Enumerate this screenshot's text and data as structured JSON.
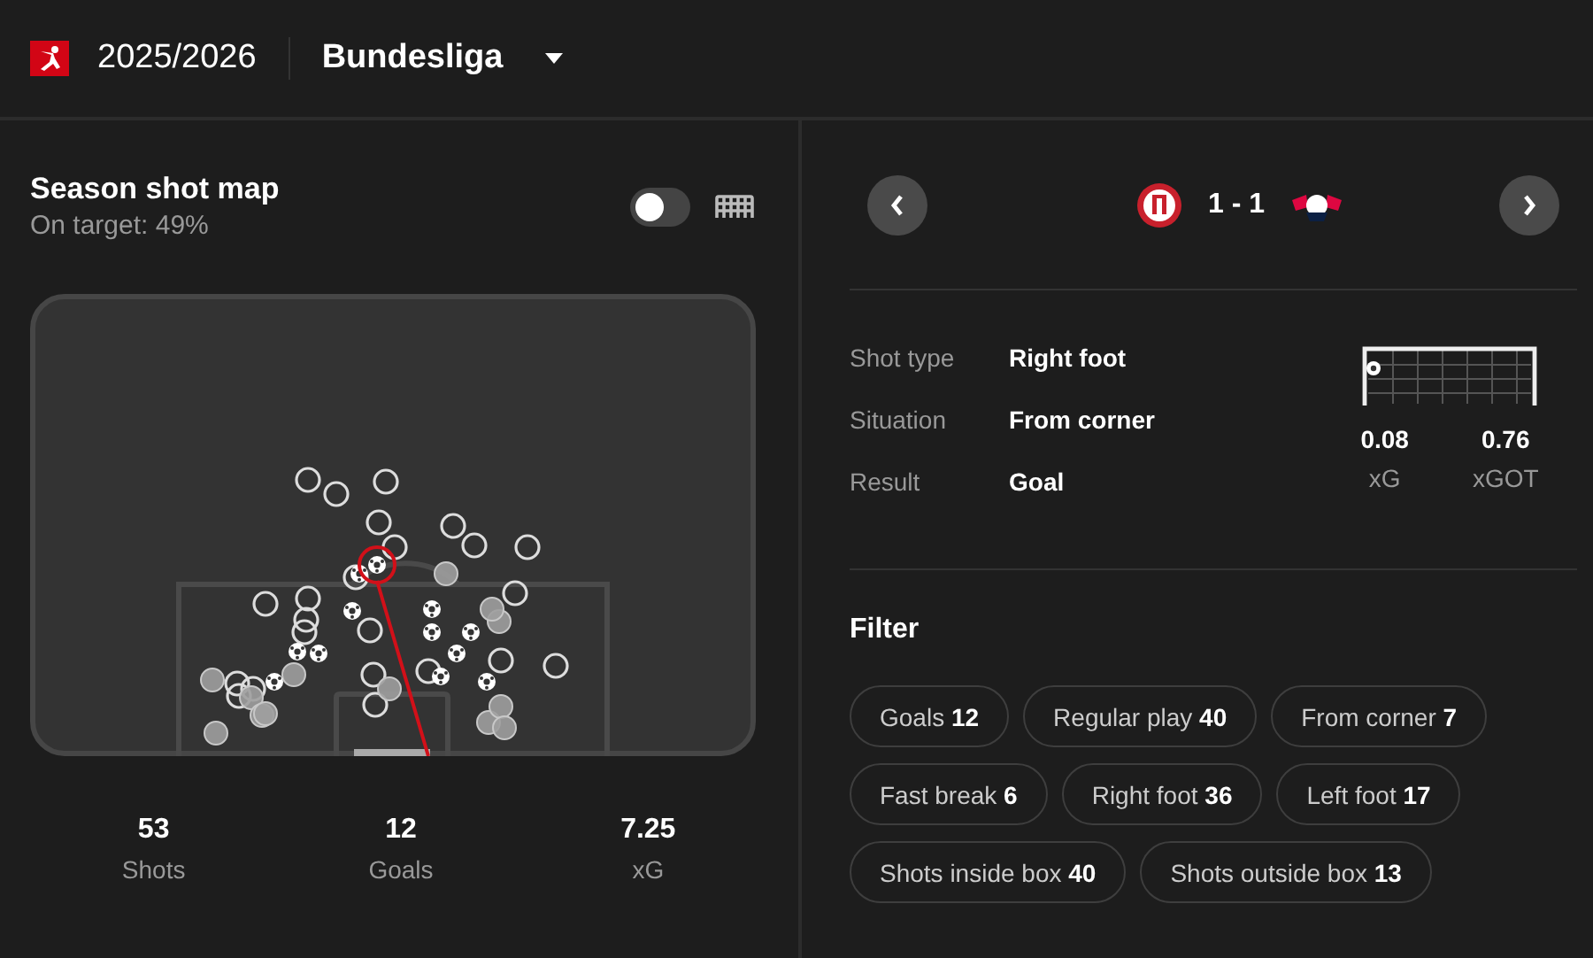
{
  "header": {
    "season": "2025/2026",
    "league": "Bundesliga"
  },
  "shot_map": {
    "title": "Season shot map",
    "subtitle": "On target: 49%",
    "toggle": {
      "on": false
    }
  },
  "stats": [
    {
      "value": "53",
      "label": "Shots"
    },
    {
      "value": "12",
      "label": "Goals"
    },
    {
      "value": "7.25",
      "label": "xG"
    }
  ],
  "match": {
    "score": "1 - 1"
  },
  "shot_details": [
    {
      "label": "Shot type",
      "value": "Right foot"
    },
    {
      "label": "Situation",
      "value": "From corner"
    },
    {
      "label": "Result",
      "value": "Goal"
    }
  ],
  "shot_metrics": [
    {
      "value": "0.08",
      "label": "xG"
    },
    {
      "value": "0.76",
      "label": "xGOT"
    }
  ],
  "filter": {
    "title": "Filter",
    "rows": [
      [
        {
          "label": "Goals",
          "count": "12",
          "selected": false
        },
        {
          "label": "Regular play",
          "count": "40",
          "selected": false
        },
        {
          "label": "From corner",
          "count": "7",
          "selected": false
        }
      ],
      [
        {
          "label": "Fast break",
          "count": "6",
          "selected": false
        },
        {
          "label": "Right foot",
          "count": "36",
          "selected": false
        },
        {
          "label": "Left foot",
          "count": "17",
          "selected": false
        }
      ],
      [
        {
          "label": "Shots inside box",
          "count": "40",
          "selected": false
        },
        {
          "label": "Shots outside box",
          "count": "13",
          "selected": false
        }
      ]
    ]
  }
}
